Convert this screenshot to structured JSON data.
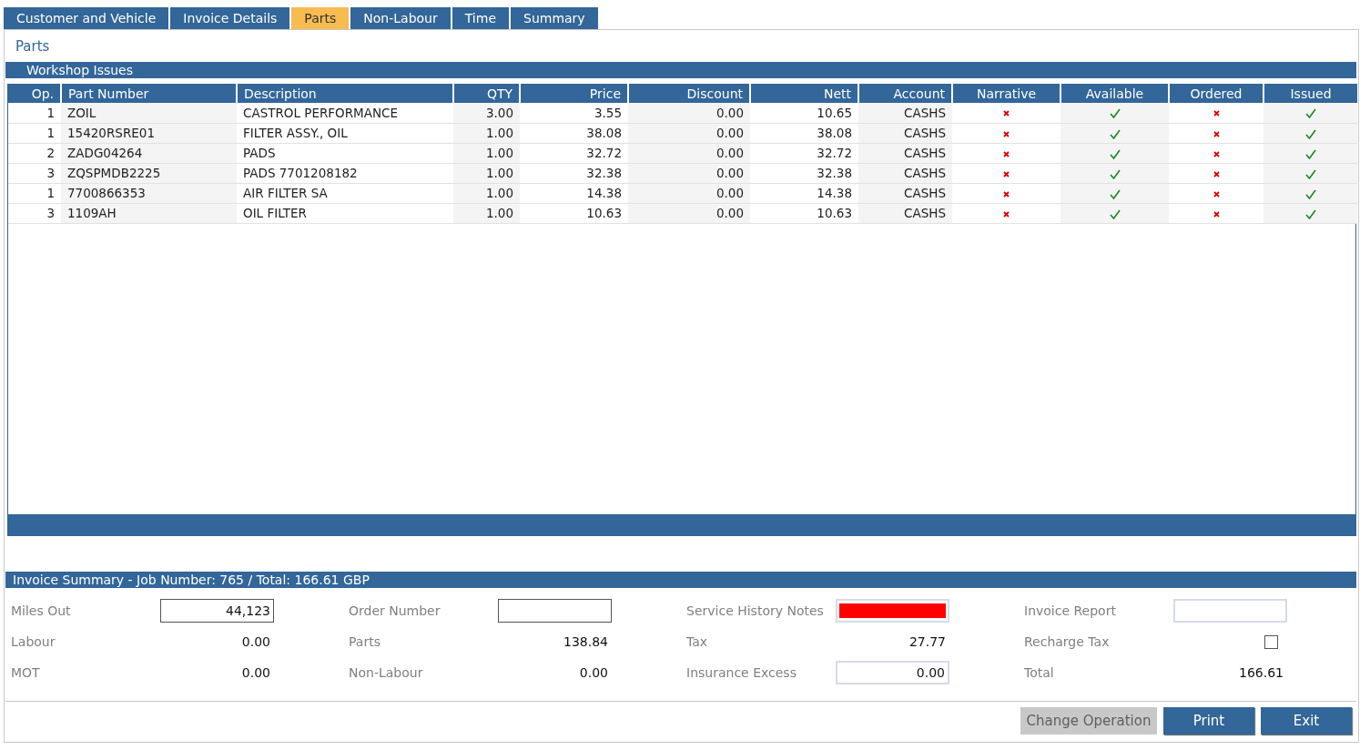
{
  "tabs": [
    {
      "label": "Customer and Vehicle",
      "selected": false
    },
    {
      "label": "Invoice Details",
      "selected": false
    },
    {
      "label": "Parts",
      "selected": true
    },
    {
      "label": "Non-Labour",
      "selected": false
    },
    {
      "label": "Time",
      "selected": false
    },
    {
      "label": "Summary",
      "selected": false
    }
  ],
  "page_title": "Parts",
  "section_title": "Workshop Issues",
  "table": {
    "columns": [
      "Op.",
      "Part Number",
      "Description",
      "QTY",
      "Price",
      "Discount",
      "Nett",
      "Account",
      "Narrative",
      "Available",
      "Ordered",
      "Issued"
    ],
    "rows": [
      {
        "op": "1",
        "part_number": "ZOIL",
        "description": "CASTROL PERFORMANCE",
        "qty": "3.00",
        "price": "3.55",
        "discount": "0.00",
        "nett": "10.65",
        "account": "CASHS",
        "narrative": false,
        "available": true,
        "ordered": false,
        "issued": true
      },
      {
        "op": "1",
        "part_number": "15420RSRE01",
        "description": "FILTER ASSY., OIL",
        "qty": "1.00",
        "price": "38.08",
        "discount": "0.00",
        "nett": "38.08",
        "account": "CASHS",
        "narrative": false,
        "available": true,
        "ordered": false,
        "issued": true
      },
      {
        "op": "2",
        "part_number": "ZADG04264",
        "description": "PADS",
        "qty": "1.00",
        "price": "32.72",
        "discount": "0.00",
        "nett": "32.72",
        "account": "CASHS",
        "narrative": false,
        "available": true,
        "ordered": false,
        "issued": true
      },
      {
        "op": "3",
        "part_number": "ZQSPMDB2225",
        "description": "PADS 7701208182",
        "qty": "1.00",
        "price": "32.38",
        "discount": "0.00",
        "nett": "32.38",
        "account": "CASHS",
        "narrative": false,
        "available": true,
        "ordered": false,
        "issued": true
      },
      {
        "op": "1",
        "part_number": "7700866353",
        "description": "AIR FILTER SA",
        "qty": "1.00",
        "price": "14.38",
        "discount": "0.00",
        "nett": "14.38",
        "account": "CASHS",
        "narrative": false,
        "available": true,
        "ordered": false,
        "issued": true
      },
      {
        "op": "3",
        "part_number": "1109AH",
        "description": "OIL FILTER",
        "qty": "1.00",
        "price": "10.63",
        "discount": "0.00",
        "nett": "10.63",
        "account": "CASHS",
        "narrative": false,
        "available": true,
        "ordered": false,
        "issued": true
      }
    ]
  },
  "summary": {
    "title": "Invoice Summary - Job Number: 765 / Total: 166.61 GBP",
    "items": [
      {
        "label": "Miles Out",
        "kind": "field",
        "value": "44,123"
      },
      {
        "label": "Order Number",
        "kind": "field",
        "value": ""
      },
      {
        "label": "Service History Notes",
        "kind": "color_field",
        "color": "#ff0000"
      },
      {
        "label": "Invoice Report",
        "kind": "light_field",
        "value": ""
      },
      {
        "label": "Labour",
        "kind": "value",
        "value": "0.00"
      },
      {
        "label": "Parts",
        "kind": "value",
        "value": "138.84"
      },
      {
        "label": "Tax",
        "kind": "value",
        "value": "27.77"
      },
      {
        "label": "Recharge Tax",
        "kind": "checkbox",
        "checked": false
      },
      {
        "label": "MOT",
        "kind": "value",
        "value": "0.00"
      },
      {
        "label": "Non-Labour",
        "kind": "value",
        "value": "0.00"
      },
      {
        "label": "Insurance Excess",
        "kind": "light_field",
        "value": "0.00"
      },
      {
        "label": "Total",
        "kind": "value",
        "value": "166.61"
      }
    ]
  },
  "buttons": [
    {
      "label": "Change Operation",
      "disabled": true
    },
    {
      "label": "Print",
      "disabled": false
    },
    {
      "label": "Exit",
      "disabled": false
    }
  ]
}
